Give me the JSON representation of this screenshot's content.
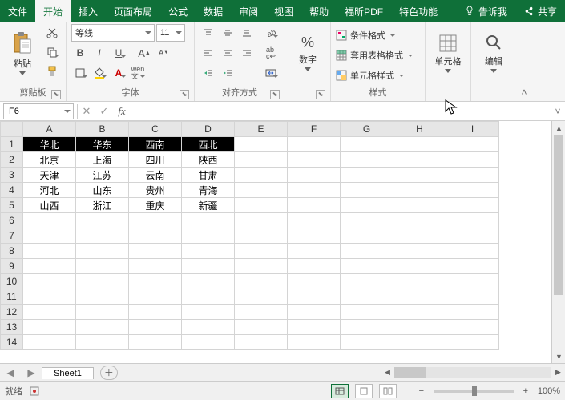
{
  "menu": {
    "tabs": [
      "文件",
      "开始",
      "插入",
      "页面布局",
      "公式",
      "数据",
      "审阅",
      "视图",
      "帮助",
      "福昕PDF",
      "特色功能"
    ],
    "active": 1,
    "tellme": "告诉我",
    "share": "共享"
  },
  "ribbon": {
    "clipboard": {
      "paste": "粘贴",
      "label": "剪贴板"
    },
    "font": {
      "name": "等线",
      "size": "11",
      "label": "字体"
    },
    "align": {
      "label": "对齐方式"
    },
    "number": {
      "btn": "数字",
      "label": ""
    },
    "styles": {
      "cond": "条件格式",
      "table": "套用表格格式",
      "cell": "单元格样式",
      "label": "样式"
    },
    "cells": {
      "btn": "单元格"
    },
    "editing": {
      "btn": "编辑"
    }
  },
  "namebox": "F6",
  "chart_data": {
    "type": "table",
    "columns": [
      "华北",
      "华东",
      "西南",
      "西北"
    ],
    "rows": [
      [
        "北京",
        "上海",
        "四川",
        "陕西"
      ],
      [
        "天津",
        "江苏",
        "云南",
        "甘肃"
      ],
      [
        "河北",
        "山东",
        "贵州",
        "青海"
      ],
      [
        "山西",
        "浙江",
        "重庆",
        "新疆"
      ]
    ]
  },
  "grid": {
    "col_letters": [
      "A",
      "B",
      "C",
      "D",
      "E",
      "F",
      "G",
      "H",
      "I"
    ],
    "row_count": 14
  },
  "sheet_tab": "Sheet1",
  "status": {
    "ready": "就绪",
    "zoom": "100%"
  }
}
